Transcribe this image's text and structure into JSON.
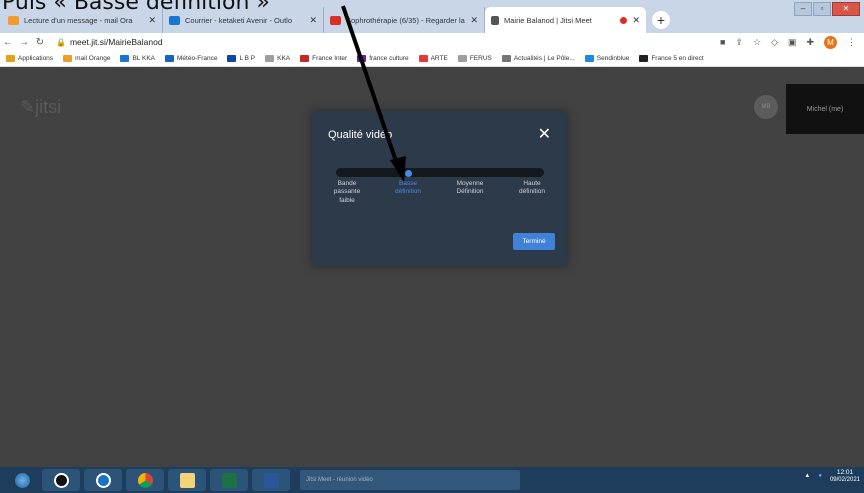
{
  "caption": "Puis « Basse définition »",
  "tabs": [
    {
      "label": "Lecture d'un message - mail Ora",
      "fav_color": "#f29b2b"
    },
    {
      "label": "Courrier - ketaketi Avenir - Outlo",
      "fav_color": "#1976d2"
    },
    {
      "label": "Sophrothérapie (6/35) - Regarder la",
      "fav_color": "#d93025"
    },
    {
      "label": "Mairie Balanod | Jitsi Meet",
      "fav_color": "#555555",
      "active": true
    }
  ],
  "new_tab": "+",
  "address": {
    "url": "meet.jit.si/MairieBalanod",
    "profile_initial": "M"
  },
  "bookmarks": [
    {
      "label": "Applications",
      "color": "#e3a21a"
    },
    {
      "label": "mail Orange",
      "color": "#f29b2b"
    },
    {
      "label": "BL KKA",
      "color": "#1976d2"
    },
    {
      "label": "Météo-France",
      "color": "#1565c0"
    },
    {
      "label": "L B P",
      "color": "#0d47a1"
    },
    {
      "label": "KKA",
      "color": "#9e9e9e"
    },
    {
      "label": "France Inter",
      "color": "#c62828"
    },
    {
      "label": "france culture",
      "color": "#6a1b9a"
    },
    {
      "label": "ARTE",
      "color": "#e53935"
    },
    {
      "label": "FERUS",
      "color": "#9e9e9e"
    },
    {
      "label": "Actualités | Le Pôle...",
      "color": "#757575"
    },
    {
      "label": "Sendinblue",
      "color": "#1e88e5"
    },
    {
      "label": "France 5 en direct",
      "color": "#212121"
    }
  ],
  "jitsi": {
    "logo": "jitsi",
    "participant_name": "Michel (me)",
    "participant_initials": "MB"
  },
  "dialog": {
    "title": "Qualité vidéo",
    "close": "✕",
    "levels": [
      "Bande\npassante\nfaible",
      "Basse\ndéfinition",
      "Moyenne\nDéfinition",
      "Haute\ndéfinition"
    ],
    "selected_index": 1,
    "done_label": "Terminé"
  },
  "taskbar": {
    "task_label": "Jitsi Meet - réunion vidéo",
    "time": "12:01",
    "date": "09/02/2021"
  },
  "colors": {
    "accent": "#4a8ae8",
    "dialog_bg": "#2d3a4a",
    "stage_bg": "#424242"
  }
}
